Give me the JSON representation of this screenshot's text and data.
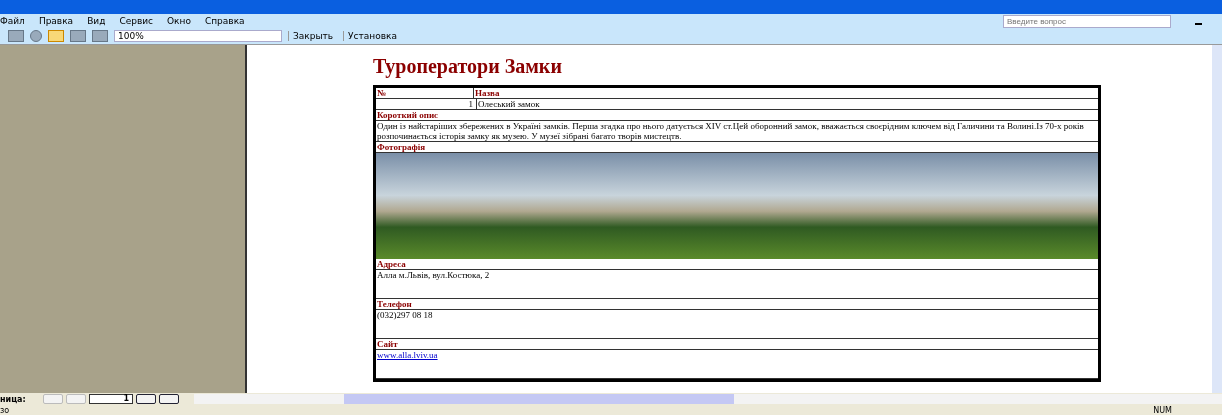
{
  "menu": [
    "Файл",
    "Правка",
    "Вид",
    "Сервис",
    "Окно",
    "Справка"
  ],
  "toolbar": {
    "zoom": "100%",
    "buttons": [
      "Закрыть",
      "Установка"
    ]
  },
  "help": {
    "placeholder": "Введите вопрос"
  },
  "report": {
    "title": "Туроператори Замки",
    "fields": [
      {
        "kind": "pair",
        "labels": [
          "№",
          "Назва"
        ],
        "values": [
          "1",
          "Олеський замок"
        ]
      },
      {
        "kind": "text",
        "label": "Короткий опис",
        "value": "Один із найстаріших збережених в Україні замків. Перша згадка про нього датується XIV  ст.Цей оборонний замок, вважається своєрідним ключем від Галичини та Волині.Із 70-х років розпочинається історія  замку як музею. У музеї зібрані багато творів мистецтв."
      },
      {
        "kind": "photo",
        "label": "Фотографія"
      },
      {
        "kind": "tall",
        "label": "Адреса",
        "value": "Алла м.Львів, вул.Костюка, 2"
      },
      {
        "kind": "tall",
        "label": "Телефон",
        "value": "(032)297 08 18"
      },
      {
        "kind": "link",
        "label": "Сайт",
        "value": "www.alla.lviv.ua"
      }
    ]
  },
  "navigator": {
    "label": "ница:",
    "page": "1"
  },
  "status": {
    "left": "зо",
    "indicator": "NUM"
  }
}
